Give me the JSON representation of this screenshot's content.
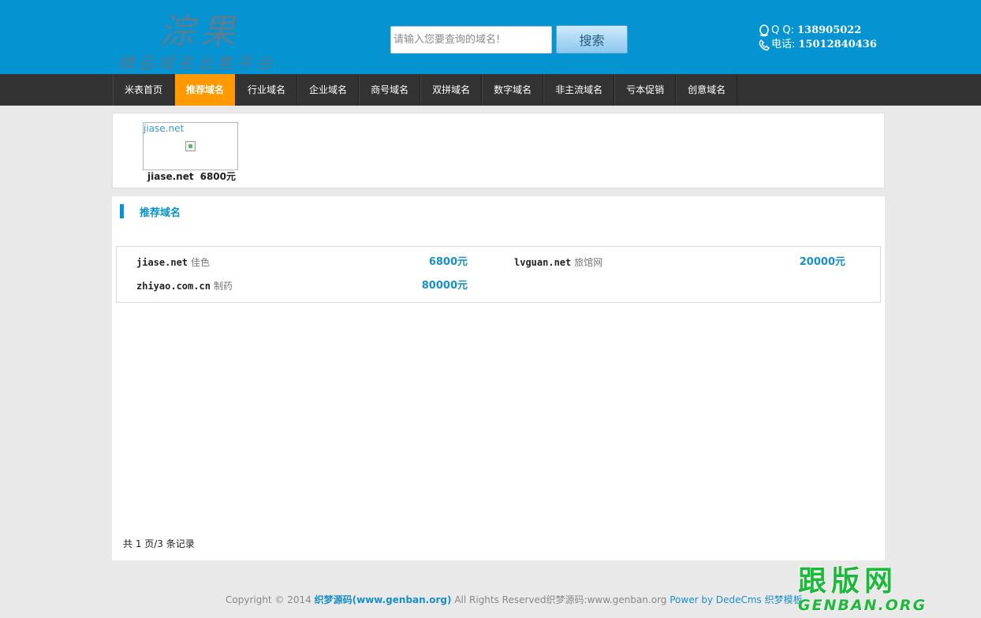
{
  "header": {
    "logo_main": "淙果",
    "logo_sub": "精品域名出售平台",
    "search_placeholder": "请输入您要查询的域名!",
    "search_button": "搜索",
    "qq_label": "Q Q:",
    "qq_number": "138905022",
    "phone_label": "电话:",
    "phone_number": "15012840436"
  },
  "nav": {
    "items": [
      {
        "label": "米表首页"
      },
      {
        "label": "推荐域名"
      },
      {
        "label": "行业域名"
      },
      {
        "label": "企业域名"
      },
      {
        "label": "商号域名"
      },
      {
        "label": "双拼域名"
      },
      {
        "label": "数字域名"
      },
      {
        "label": "非主流域名"
      },
      {
        "label": "亏本促销"
      },
      {
        "label": "创意域名"
      }
    ],
    "active_index": 1
  },
  "featured": {
    "image_alt": "jiase.net",
    "name": "jiase.net",
    "price": "6800元"
  },
  "section": {
    "title": "推荐域名"
  },
  "domains": [
    {
      "name": "jiase.net",
      "desc": "佳色",
      "price": "6800元"
    },
    {
      "name": "lvguan.net",
      "desc": "旅馆网",
      "price": "20000元"
    },
    {
      "name": "zhiyao.com.cn",
      "desc": "制药",
      "price": "80000元"
    }
  ],
  "pager": {
    "text": "共 1 页/3 条记录"
  },
  "footer": {
    "copyright": "Copyright © 2014",
    "brand": "织梦源码(www.genban.org)",
    "rights": "All Rights Reserved织梦源码:www.genban.org",
    "powered": "Power by DedeCms 织梦模板"
  },
  "watermark": {
    "top": "跟版网",
    "bottom": "GENBAN.ORG"
  },
  "colors": {
    "header_bg": "#0593d1",
    "nav_bg": "#333333",
    "nav_active": "#ff9900",
    "accent": "#1a8fc4",
    "watermark": "#1db93a"
  }
}
